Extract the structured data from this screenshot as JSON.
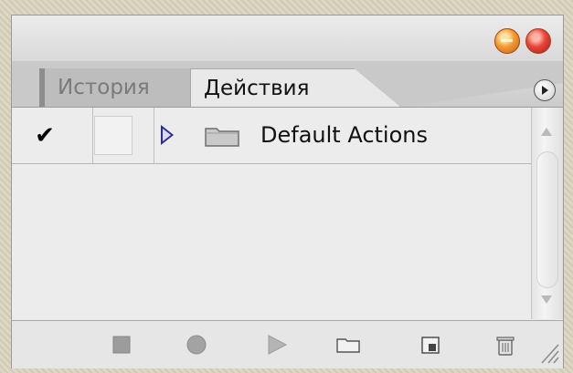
{
  "window": {
    "buttons": [
      "minimize",
      "close"
    ]
  },
  "tabs": [
    {
      "label": "История",
      "active": false
    },
    {
      "label": "Действия",
      "active": true
    }
  ],
  "actions_list": {
    "rows": [
      {
        "checked": true,
        "check_glyph": "✔",
        "dialog_toggle": false,
        "expanded": false,
        "icon": "folder-icon",
        "label": "Default Actions"
      }
    ]
  },
  "toolbar": {
    "icons": [
      "stop-icon",
      "record-icon",
      "play-icon",
      "new-set-folder-icon",
      "new-action-icon",
      "trash-icon"
    ]
  },
  "colors": {
    "panel_bg": "#e9e9e9",
    "active_tab_bg": "#e9e9e9",
    "inactive_tab_text": "#7a7a7a",
    "minimize_button": "#f39a32",
    "close_button": "#e8453a",
    "expand_triangle": "#2e2e8a"
  }
}
